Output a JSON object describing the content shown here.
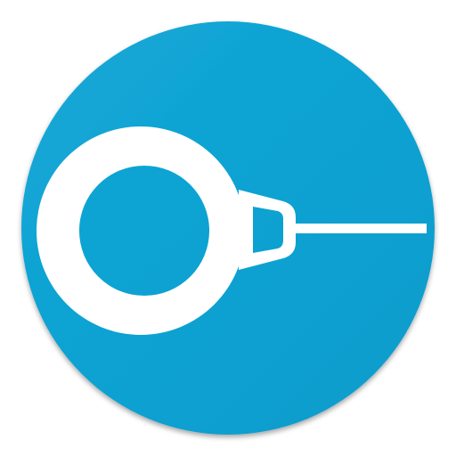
{
  "app_icon": {
    "name": "app-icon",
    "depicts": "ring-with-cable-icon",
    "colors": {
      "circle_fill": "#0a9ccc",
      "circle_fill_light": "#14a8d8",
      "glyph": "#ffffff",
      "shadow": "#2a4a55"
    }
  }
}
